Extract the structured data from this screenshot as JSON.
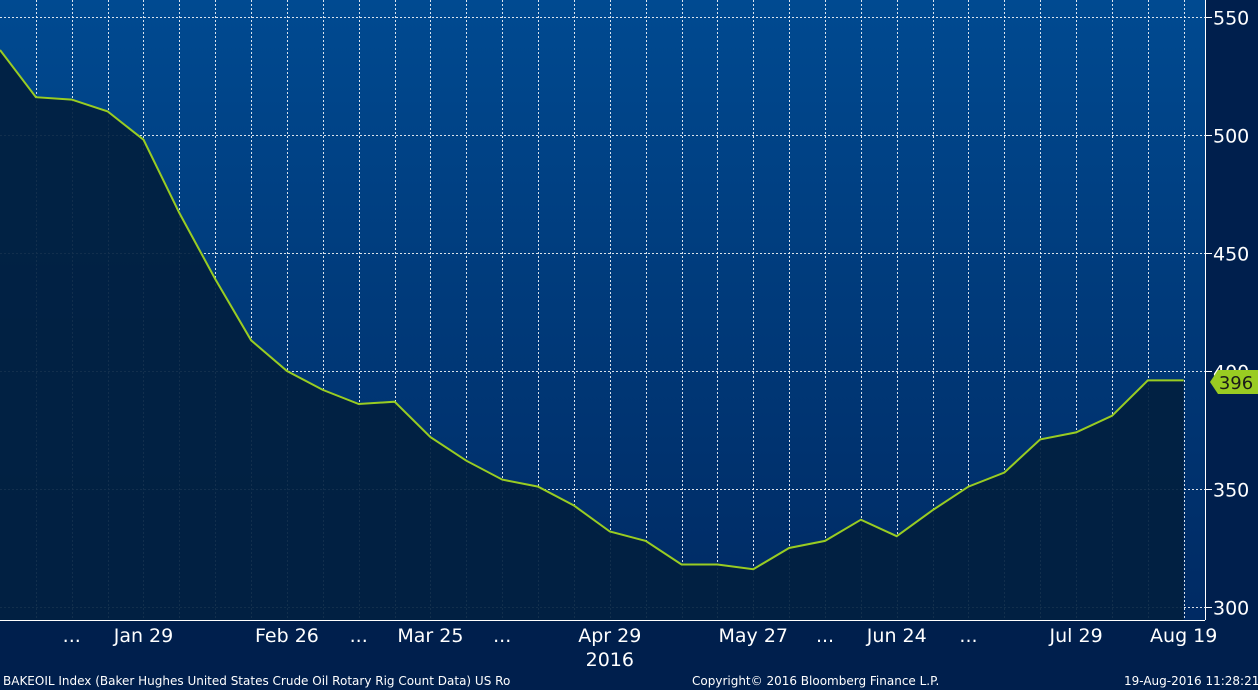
{
  "footer": {
    "left": "BAKEOIL Index (Baker Hughes United States Crude Oil Rotary Rig Count Data) US Ro",
    "center": "Copyright© 2016 Bloomberg Finance L.P.",
    "right": "19-Aug-2016 11:28:21"
  },
  "colors": {
    "background_top": "#004a91",
    "background_bottom": "#001f4d",
    "area_fill": "#01203f",
    "line": "#99cc22",
    "text": "#ffffff",
    "gridline": "#ffffff"
  },
  "chart_data": {
    "type": "area",
    "title": "",
    "xlabel": "",
    "ylabel": "",
    "ylim": [
      295,
      555
    ],
    "yticks": [
      300,
      350,
      400,
      450,
      500,
      550
    ],
    "grid": true,
    "year_label": "2016",
    "x_tick_labels": [
      "...",
      "Jan 29",
      "Feb 26",
      "...",
      "Mar 25",
      "...",
      "Apr 29",
      "May 27",
      "...",
      "Jun 24",
      "...",
      "Jul 29",
      "Aug 19"
    ],
    "last_value_label": "396",
    "series": [
      {
        "x": [
          "2016-01-01",
          "2016-01-08",
          "2016-01-15",
          "2016-01-22",
          "2016-01-29",
          "2016-02-05",
          "2016-02-12",
          "2016-02-19",
          "2016-02-26",
          "2016-03-04",
          "2016-03-11",
          "2016-03-18",
          "2016-03-25",
          "2016-04-01",
          "2016-04-08",
          "2016-04-15",
          "2016-04-22",
          "2016-04-29",
          "2016-05-06",
          "2016-05-13",
          "2016-05-20",
          "2016-05-27",
          "2016-06-03",
          "2016-06-10",
          "2016-06-17",
          "2016-06-24",
          "2016-07-01",
          "2016-07-08",
          "2016-07-15",
          "2016-07-22",
          "2016-07-29",
          "2016-08-05",
          "2016-08-12",
          "2016-08-19"
        ],
        "values": [
          536,
          516,
          515,
          510,
          498,
          467,
          439,
          413,
          400,
          392,
          386,
          387,
          372,
          362,
          354,
          351,
          343,
          332,
          328,
          318,
          318,
          316,
          325,
          328,
          337,
          330,
          341,
          351,
          357,
          371,
          374,
          381,
          396,
          396
        ]
      }
    ]
  }
}
